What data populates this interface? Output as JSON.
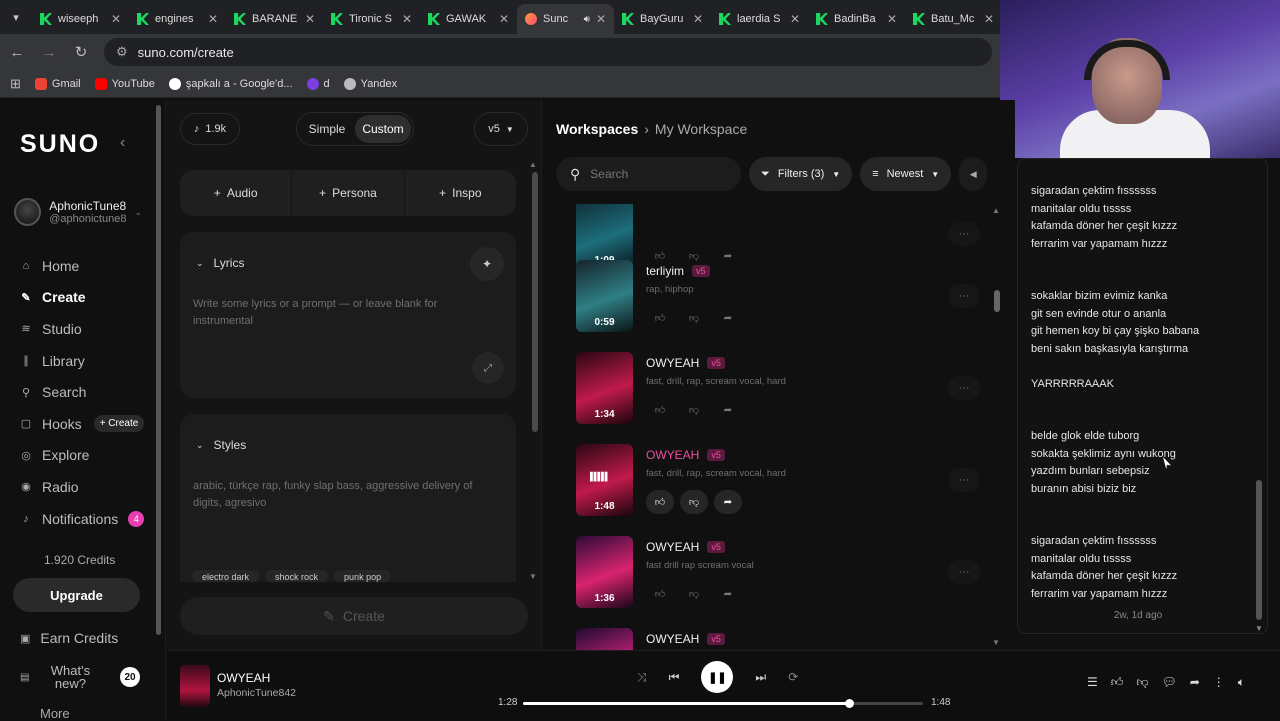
{
  "browser": {
    "tabs": [
      {
        "title": "wiseeph",
        "active": false
      },
      {
        "title": "engines",
        "active": false
      },
      {
        "title": "BARANE",
        "active": false
      },
      {
        "title": "Tironic S",
        "active": false
      },
      {
        "title": "GAWAK",
        "active": false
      },
      {
        "title": "Sunc",
        "active": true
      },
      {
        "title": "BayGuru",
        "active": false
      },
      {
        "title": "laerdia S",
        "active": false
      },
      {
        "title": "BadinBa",
        "active": false
      },
      {
        "title": "Batu_Mc",
        "active": false
      }
    ],
    "url": "suno.com/create",
    "bookmarks": [
      "Gmail",
      "YouTube",
      "şapkalı a - Google'd...",
      "d",
      "Yandex"
    ]
  },
  "sidebar": {
    "logo": "SUNO",
    "user_name": "AphonicTune8",
    "user_handle": "@aphonictune8",
    "nav": [
      {
        "label": "Home",
        "icon": "home-icon",
        "glyph": "⌂"
      },
      {
        "label": "Create",
        "icon": "create-icon",
        "glyph": "✎",
        "active": true
      },
      {
        "label": "Studio",
        "icon": "studio-icon",
        "glyph": "≋"
      },
      {
        "label": "Library",
        "icon": "library-icon",
        "glyph": "∥"
      },
      {
        "label": "Search",
        "icon": "search-icon",
        "glyph": "⚲"
      },
      {
        "label": "Hooks",
        "icon": "hooks-icon",
        "glyph": "▢",
        "pill": "+ Create"
      },
      {
        "label": "Explore",
        "icon": "explore-icon",
        "glyph": "◎"
      },
      {
        "label": "Radio",
        "icon": "radio-icon",
        "glyph": "◉"
      },
      {
        "label": "Notifications",
        "icon": "bell-icon",
        "glyph": "♪",
        "badge": "4"
      }
    ],
    "credits": "1.920 Credits",
    "upgrade": "Upgrade",
    "earn": "Earn Credits",
    "whats_new": "What's new?",
    "whats_new_count": "20",
    "more": "More"
  },
  "create": {
    "credit_count": "1.9k",
    "mode_simple": "Simple",
    "mode_custom": "Custom",
    "version": "v5",
    "add_audio": "Audio",
    "add_persona": "Persona",
    "add_inspo": "Inspo",
    "lyrics_title": "Lyrics",
    "lyrics_placeholder": "Write some lyrics or a prompt — or leave blank for instrumental",
    "styles_title": "Styles",
    "styles_value": "arabic, türkçe rap, funky slap bass, aggressive delivery of digits, agresivo",
    "style_chips": [
      "electro dark",
      "shock rock",
      "punk pop"
    ],
    "create_label": "Create"
  },
  "workspace": {
    "crumb_root": "Workspaces",
    "crumb_current": "My Workspace",
    "search_placeholder": "Search",
    "filters": "Filters (3)",
    "sort": "Newest",
    "songs": [
      {
        "title": "",
        "tags": "",
        "duration": "1:09",
        "version": "",
        "colors": [
          "#0e2a33",
          "#1d6e7c",
          "#081216"
        ]
      },
      {
        "title": "terliyim",
        "tags": "rap, hiphop",
        "duration": "0:59",
        "version": "v5",
        "colors": [
          "#15232b",
          "#2f7f85",
          "#0b1416"
        ]
      },
      {
        "title": "OWYEAH",
        "tags": "fast, drill, rap, scream vocal, hard",
        "duration": "1:34",
        "version": "v5",
        "colors": [
          "#2a0712",
          "#c01a4c",
          "#1a050b"
        ]
      },
      {
        "title": "OWYEAH",
        "tags": "fast, drill, rap, scream vocal, hard",
        "duration": "1:48",
        "version": "v5",
        "playing": true,
        "colors": [
          "#2a0712",
          "#c01a4c",
          "#1a050b"
        ]
      },
      {
        "title": "OWYEAH",
        "tags": "fast drill rap scream vocal",
        "duration": "1:36",
        "version": "v5",
        "colors": [
          "#2c0a38",
          "#d9246f",
          "#1a0618"
        ]
      },
      {
        "title": "OWYEAH",
        "tags": "",
        "duration": "",
        "version": "v5",
        "colors": [
          "#1d0a30",
          "#c8227a",
          "#12061e"
        ]
      }
    ]
  },
  "lyrics_panel": {
    "lines": [
      "sigaradan çektim fıssssss",
      "manitalar oldu tıssss",
      "kafamda döner her çeşit kızzz",
      "ferrarim var yapamam hızzz",
      "",
      "",
      "sokaklar bizim evimiz kanka",
      "git sen evinde otur o ananla",
      "git hemen koy bi çay şişko babana",
      "beni sakın başkasıyla karıştırma",
      "",
      "YARRRRRAAAK",
      "",
      "",
      "belde glok elde tuborg",
      "sokakta şeklimiz aynı wukong",
      "yazdım bunları sebepsiz",
      "buranın abisi biziz biz",
      "",
      "",
      "sigaradan çektim fıssssss",
      "manitalar oldu tıssss",
      "kafamda döner her çeşit kızzz",
      "ferrarim var yapamam hızzz"
    ],
    "timestamp": "2w, 1d ago"
  },
  "player": {
    "title": "OWYEAH",
    "artist": "AphonicTune842",
    "current": "1:28",
    "total": "1:48",
    "progress": 0.8148
  }
}
